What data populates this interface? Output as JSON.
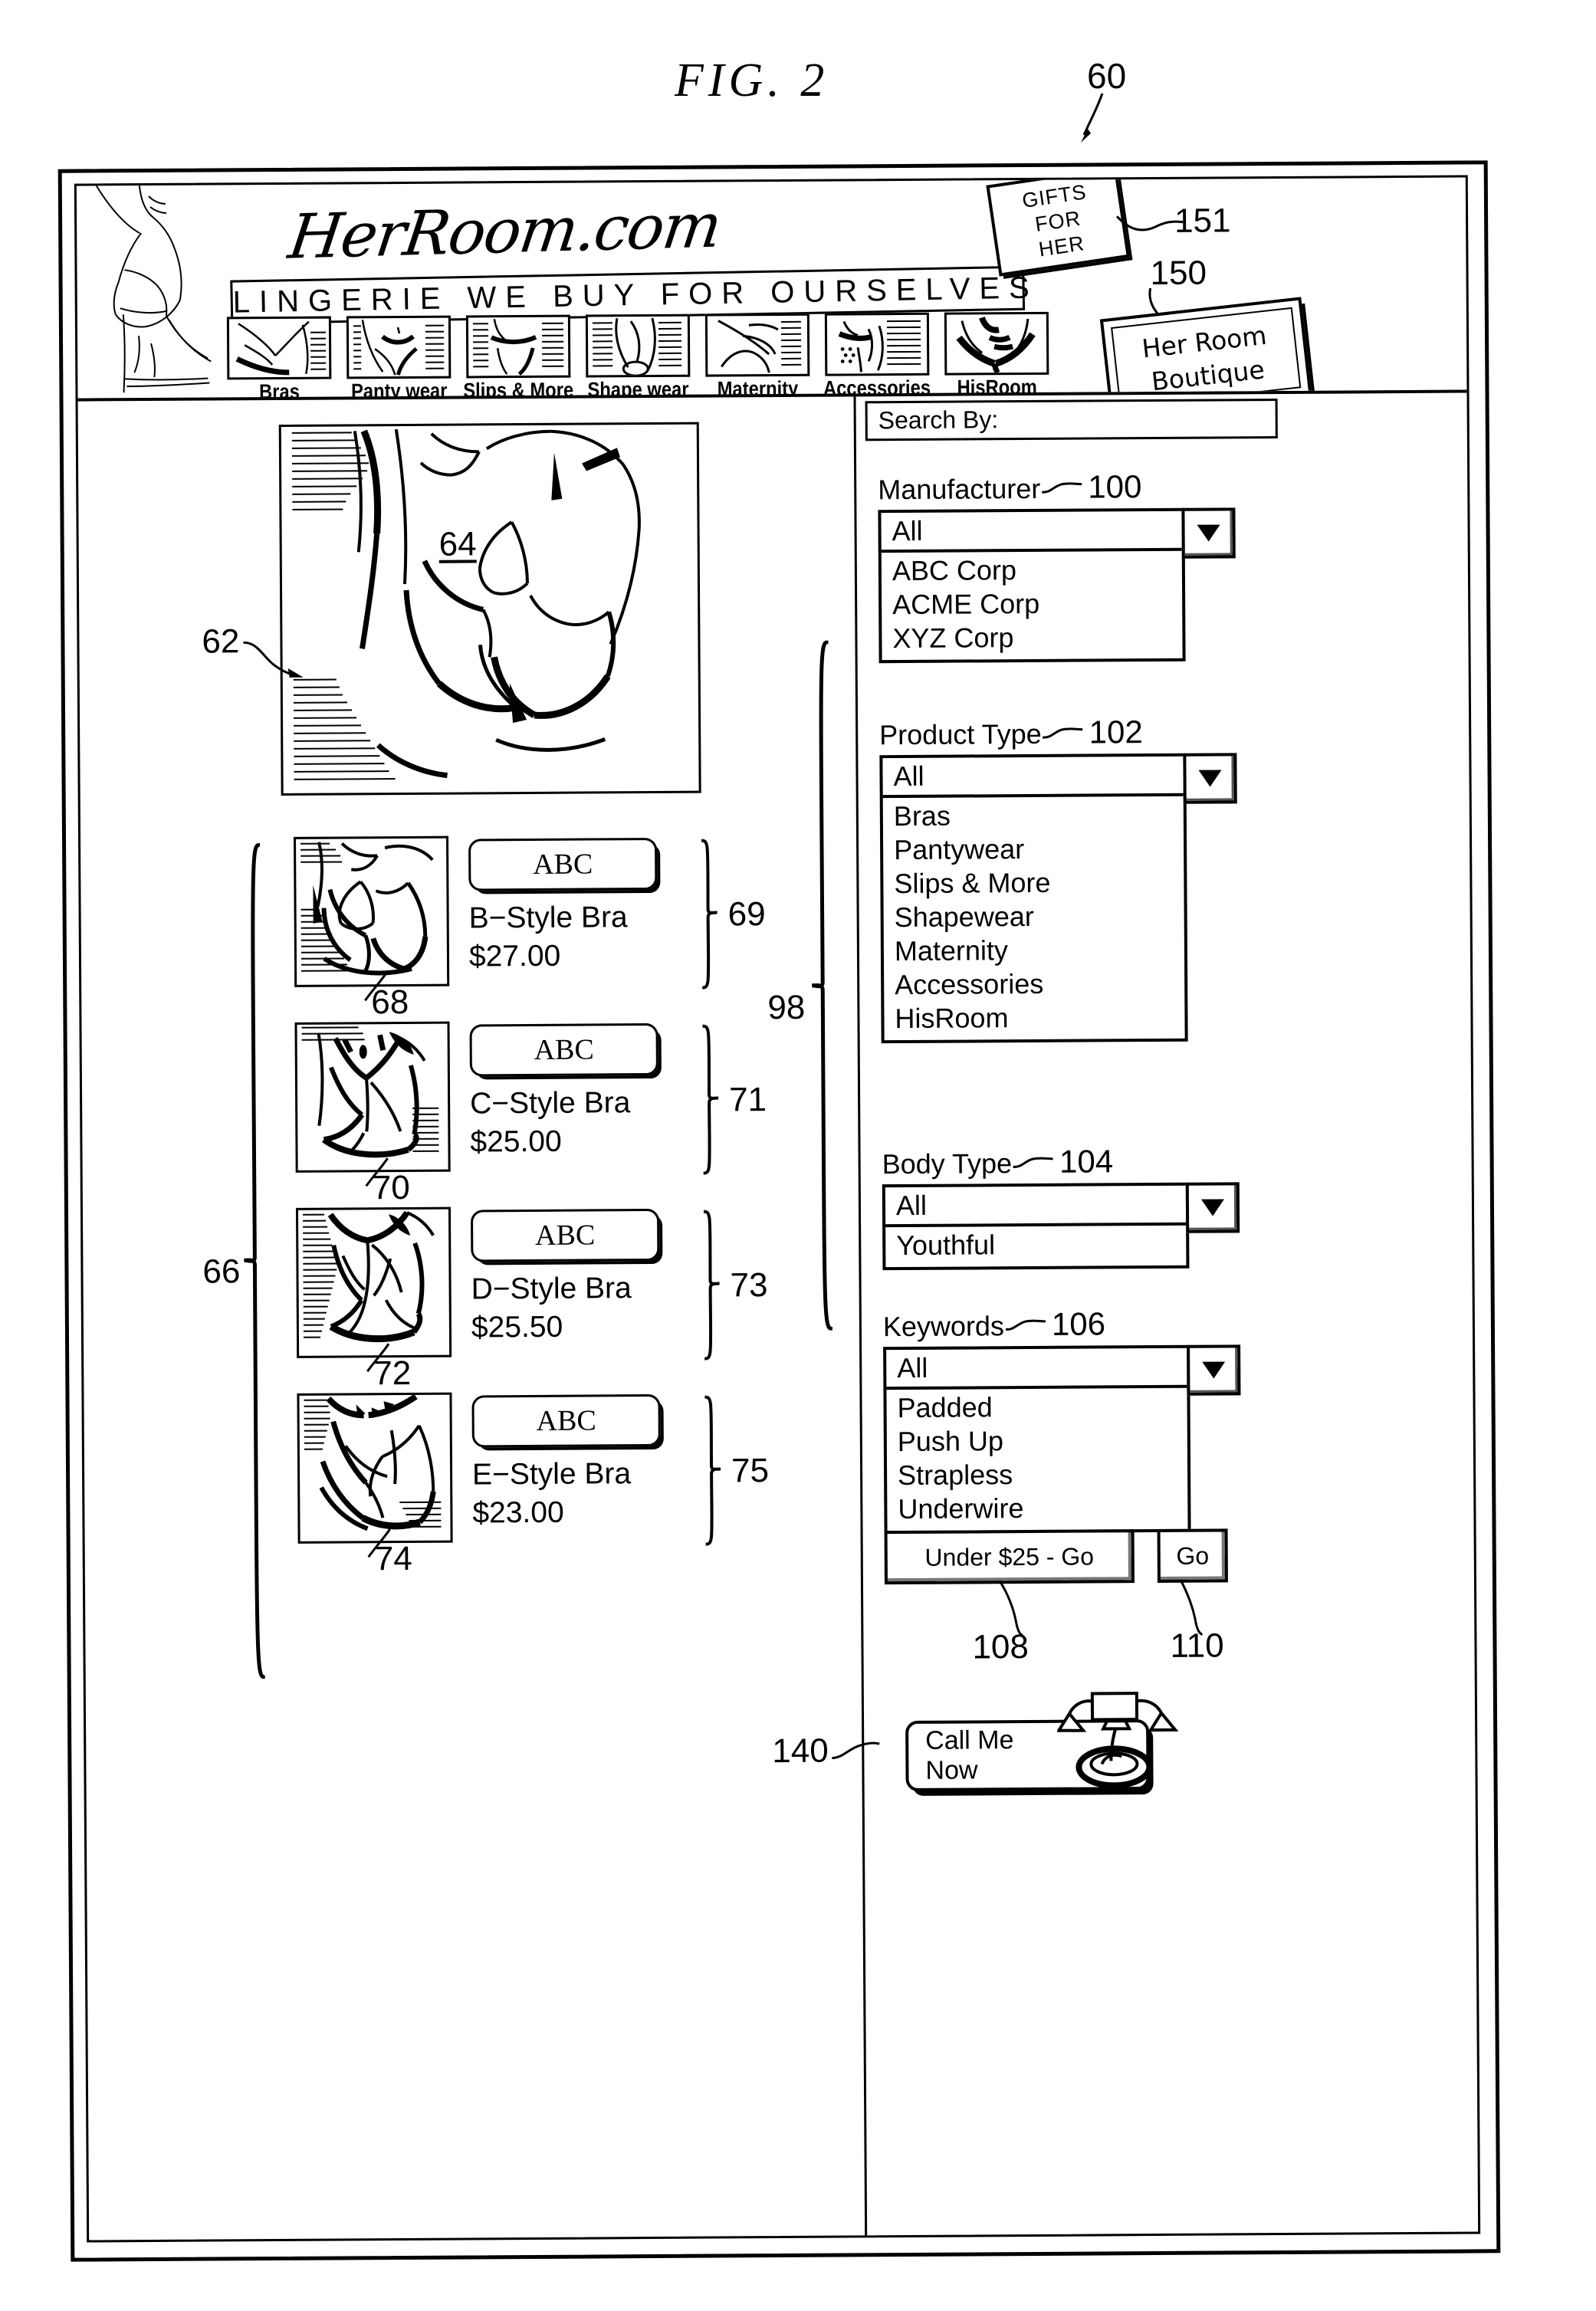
{
  "figure": {
    "title": "FIG.  2",
    "ref_main": "60"
  },
  "header": {
    "logo": "HerRoom.com",
    "tagline": "LINGERIE WE BUY FOR OURSELVES",
    "gifts_card": {
      "line1": "GIFTS",
      "line2": "FOR",
      "line3": "HER",
      "ref": "151"
    },
    "boutique_card": {
      "line1": "Her  Room",
      "line2": "Boutique",
      "ref": "150"
    },
    "nav": [
      {
        "label": "Bras"
      },
      {
        "label": "Panty wear"
      },
      {
        "label": "Slips & More"
      },
      {
        "label": "Shape wear"
      },
      {
        "label": "Maternity"
      },
      {
        "label": "Accessories"
      },
      {
        "label": "HisRoom"
      }
    ]
  },
  "main": {
    "hero": {
      "ref_image": "62",
      "ref_detail": "64"
    },
    "list_ref": "66",
    "products": [
      {
        "brand": "ABC",
        "name": "B−Style  Bra",
        "price": "$27.00",
        "ref_row": "69",
        "ref_image": "68"
      },
      {
        "brand": "ABC",
        "name": "C−Style  Bra",
        "price": "$25.00",
        "ref_row": "71",
        "ref_image": "70"
      },
      {
        "brand": "ABC",
        "name": "D−Style  Bra",
        "price": "$25.50",
        "ref_row": "73",
        "ref_image": "72"
      },
      {
        "brand": "ABC",
        "name": "E−Style  Bra",
        "price": "$23.00",
        "ref_row": "75",
        "ref_image": "74"
      }
    ]
  },
  "sidebar": {
    "heading": "Search By:",
    "group_ref": "98",
    "fields": [
      {
        "label": "Manufacturer",
        "ref": "100",
        "selected": "All",
        "options": [
          "ABC  Corp",
          "ACME  Corp",
          "XYZ  Corp"
        ]
      },
      {
        "label": "Product  Type",
        "ref": "102",
        "selected": "All",
        "options": [
          "Bras",
          "Pantywear",
          "Slips  &  More",
          "Shapewear",
          "Maternity",
          "Accessories",
          "HisRoom"
        ]
      },
      {
        "label": "Body  Type",
        "ref": "104",
        "selected": "All",
        "options": [
          "Youthful"
        ]
      },
      {
        "label": "Keywords",
        "ref": "106",
        "selected": "All",
        "options": [
          "Padded",
          "Push Up",
          "Strapless",
          "Underwire"
        ]
      }
    ],
    "buttons": {
      "under_label": "Under $25 - Go",
      "under_ref": "108",
      "go_label": "Go",
      "go_ref": "110"
    },
    "callme": {
      "line1": "Call  Me",
      "line2": "Now",
      "ref": "140"
    }
  }
}
